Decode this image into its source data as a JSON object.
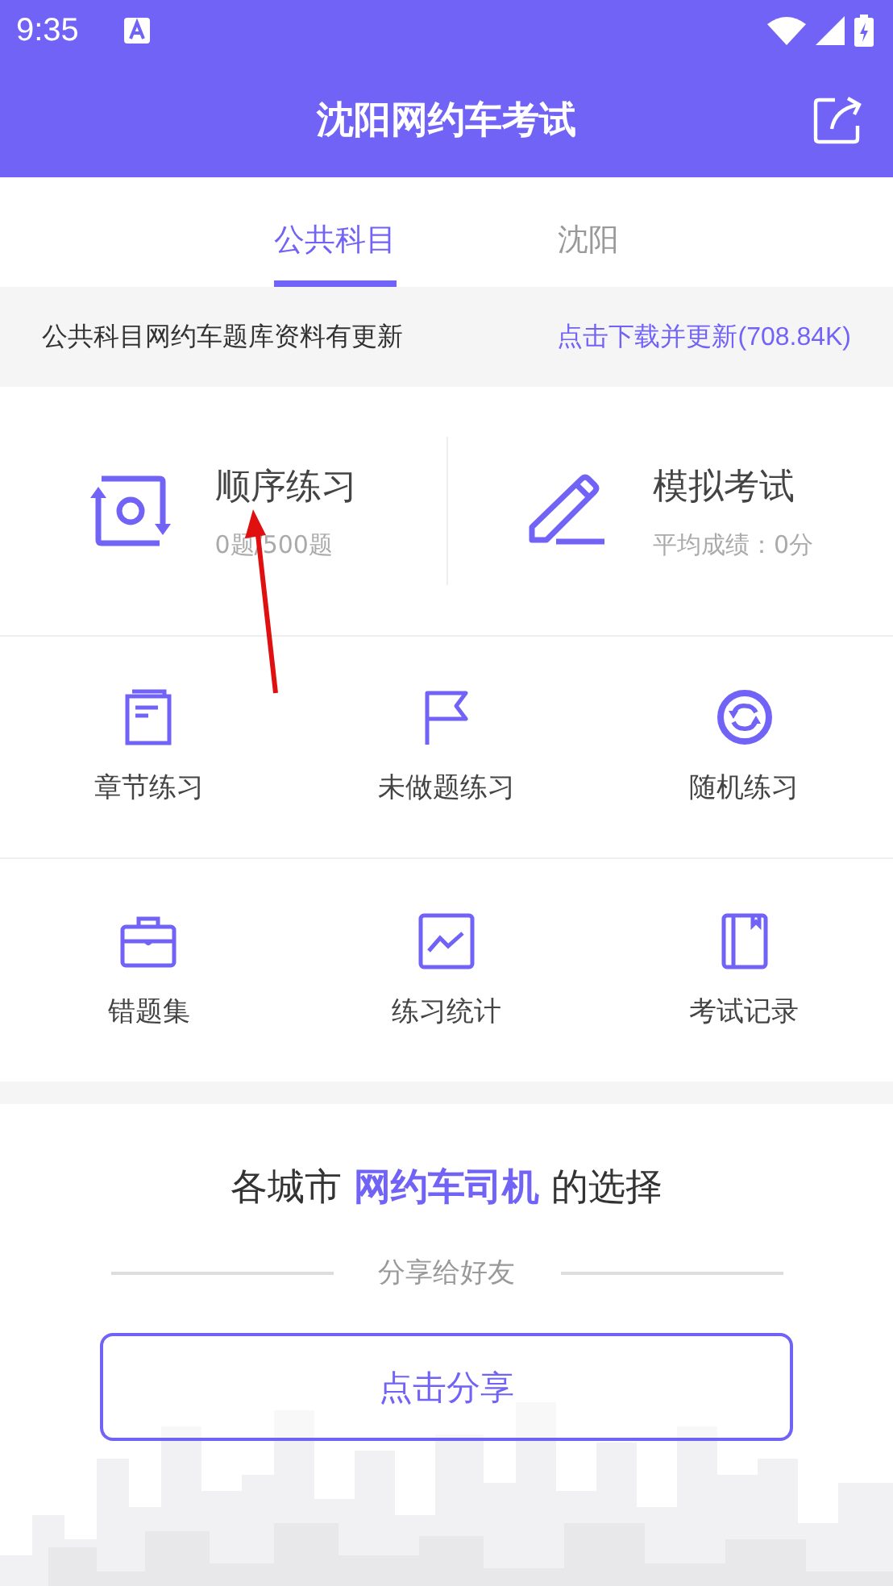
{
  "status_bar": {
    "time": "9:35"
  },
  "header": {
    "title": "沈阳网约车考试"
  },
  "tabs": [
    {
      "label": "公共科目",
      "selected": true
    },
    {
      "label": "沈阳",
      "selected": false
    }
  ],
  "notice": {
    "text": "公共科目网约车题库资料有更新",
    "link": "点击下载并更新(708.84K)"
  },
  "main_features": [
    {
      "kind": "sequence",
      "title": "顺序练习",
      "subtitle": "0题/500题"
    },
    {
      "kind": "mock",
      "title": "模拟考试",
      "subtitle": "平均成绩：0分"
    }
  ],
  "grid": [
    {
      "kind": "chapter",
      "label": "章节练习"
    },
    {
      "kind": "unanswered",
      "label": "未做题练习"
    },
    {
      "kind": "random",
      "label": "随机练习"
    },
    {
      "kind": "mistakes",
      "label": "错题集"
    },
    {
      "kind": "stats",
      "label": "练习统计"
    },
    {
      "kind": "records",
      "label": "考试记录"
    }
  ],
  "promo": {
    "headline": "各城市 **网约车司机** 的选择",
    "divider_text": "分享给好友",
    "button": "点击分享"
  }
}
